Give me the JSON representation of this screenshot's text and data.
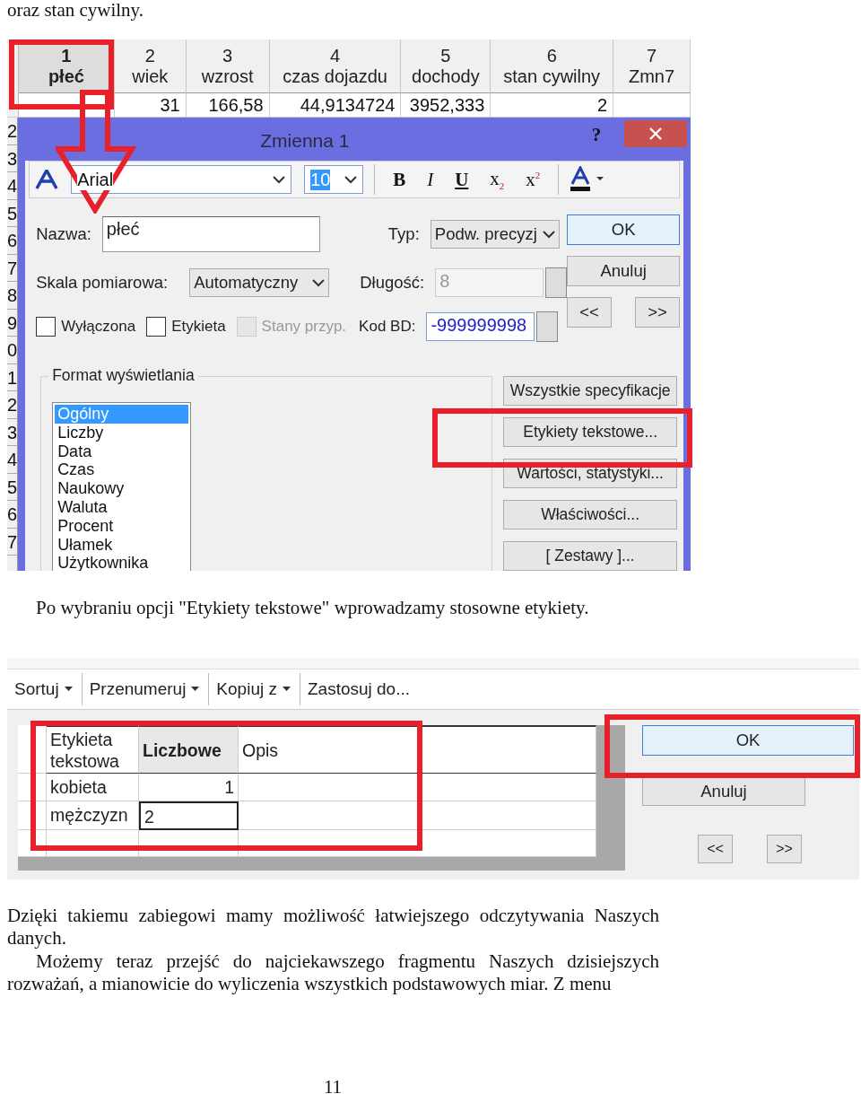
{
  "intro_text": "oraz stan cywilny.",
  "screenshot_1": {
    "columns": [
      {
        "number": "1",
        "name": "płeć",
        "selected": true
      },
      {
        "number": "2",
        "name": "wiek",
        "selected": false
      },
      {
        "number": "3",
        "name": "wzrost",
        "selected": false
      },
      {
        "number": "4",
        "name": "czas dojazdu",
        "selected": false
      },
      {
        "number": "5",
        "name": "dochody",
        "selected": false
      },
      {
        "number": "6",
        "name": "stan cywilny",
        "selected": false
      },
      {
        "number": "7",
        "name": "Zmn7",
        "selected": false
      }
    ],
    "first_row": [
      "31",
      "166,58",
      "44,9134724",
      "3952,333",
      "2"
    ],
    "row_numbers": [
      "2",
      "3",
      "4",
      "5",
      "6",
      "7",
      "8",
      "9",
      "0",
      "1",
      "2",
      "3",
      "4",
      "5",
      "6",
      "7"
    ],
    "dialog": {
      "title": "Zmienna 1",
      "help": "?",
      "font": "Arial",
      "font_size": "10",
      "format_buttons": [
        "B",
        "I",
        "U",
        "x$_{2}$",
        "x$^{2}$"
      ],
      "name_label": "Nazwa:",
      "name_value": "płeć",
      "type_label": "Typ:",
      "type_value": "Podw. precyzj",
      "scale_label": "Skala pomiarowa:",
      "scale_value": "Automatyczny",
      "length_label": "Długość:",
      "length_value": "8",
      "length_disabled": true,
      "checkboxes": [
        {
          "label": "Wyłączona",
          "checked": false,
          "disabled": false
        },
        {
          "label": "Etykieta",
          "checked": false,
          "disabled": false
        },
        {
          "label": "Stany przyp.",
          "checked": false,
          "disabled": true
        }
      ],
      "code_label": "Kod BD:",
      "code_value": "-999999998",
      "side_buttons": [
        {
          "label": "OK",
          "focused": true
        },
        {
          "label": "Anuluj",
          "focused": false
        }
      ],
      "nav_buttons": [
        "<<",
        ">>"
      ],
      "format_group": {
        "title": "Format wyświetlania",
        "items": [
          {
            "label": "Ogólny",
            "selected": true
          },
          {
            "label": "Liczby",
            "selected": false
          },
          {
            "label": "Data",
            "selected": false
          },
          {
            "label": "Czas",
            "selected": false
          },
          {
            "label": "Naukowy",
            "selected": false
          },
          {
            "label": "Waluta",
            "selected": false
          },
          {
            "label": "Procent",
            "selected": false
          },
          {
            "label": "Ułamek",
            "selected": false
          },
          {
            "label": "Użytkownika",
            "selected": false
          }
        ]
      },
      "action_buttons": [
        "Wszystkie specyfikacje",
        "Etykiety tekstowe...",
        "Wartości, statystyki...",
        "Właściwości...",
        "[ Zestawy ]..."
      ]
    }
  },
  "caption": "Po wybraniu opcji \"Etykiety tekstowe\" wprowadzamy stosowne etykiety.",
  "screenshot_2": {
    "menu": [
      {
        "label": "Sortuj",
        "dropdown": true
      },
      {
        "label": "Przenumeruj",
        "dropdown": true
      },
      {
        "label": "Kopiuj z",
        "dropdown": true
      },
      {
        "label": "Zastosuj do...",
        "dropdown": false
      }
    ],
    "columns": [
      {
        "label": "Etykieta tekstowa",
        "selected": false
      },
      {
        "label": "Liczbowe",
        "selected": true
      },
      {
        "label": "Opis",
        "selected": false
      }
    ],
    "rows": [
      {
        "label": "kobieta",
        "value": "1",
        "editing": false
      },
      {
        "label": "mężczyzn",
        "value": "2",
        "editing": true
      }
    ],
    "buttons": [
      {
        "label": "OK",
        "focused": true
      },
      {
        "label": "Anuluj",
        "focused": false
      }
    ],
    "nav_buttons": [
      "<<",
      ">>"
    ]
  },
  "paragraphs": [
    {
      "text": "Dzięki takiemu zabiegowi mamy możliwość łatwiejszego odczytywania Naszych danych.",
      "indent": false
    },
    {
      "text": "Możemy teraz przejść do najciekawszego fragmentu Naszych dzisiejszych rozważań, a mianowicie do wyliczenia wszystkich podstawowych miar. Z menu",
      "indent": true
    }
  ],
  "page_number": "11"
}
